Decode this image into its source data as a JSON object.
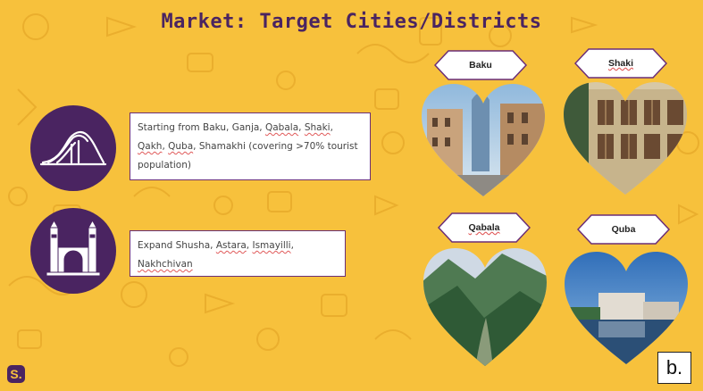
{
  "slide": {
    "title": "Market: Target Cities/Districts",
    "colors": {
      "background": "#f7c13c",
      "accent": "#4a2461",
      "border": "#6a2e78"
    }
  },
  "left": {
    "items": [
      {
        "icon": "heydar-aliyev-center-icon",
        "segments": [
          {
            "text": "Starting from Baku, Ganja, ",
            "u": false
          },
          {
            "text": "Qabala",
            "u": true
          },
          {
            "text": ", ",
            "u": false
          },
          {
            "text": "Shaki",
            "u": true
          },
          {
            "text": ", ",
            "u": false
          },
          {
            "text": "Qakh",
            "u": true
          },
          {
            "text": ", ",
            "u": false
          },
          {
            "text": "Quba",
            "u": true
          },
          {
            "text": ", Shamakhi (covering >70% tourist population)",
            "u": false
          }
        ]
      },
      {
        "icon": "mosque-icon",
        "segments": [
          {
            "text": "Expand Shusha, ",
            "u": false
          },
          {
            "text": "Astara",
            "u": true
          },
          {
            "text": ", ",
            "u": false
          },
          {
            "text": "Ismayilli",
            "u": true
          },
          {
            "text": ", ",
            "u": false
          },
          {
            "text": "Nakhchivan",
            "u": true
          }
        ]
      }
    ]
  },
  "cities": [
    {
      "label": "Baku",
      "photo": "baku-photo"
    },
    {
      "label": "Shaki",
      "photo": "shaki-photo"
    },
    {
      "label": "Qabala",
      "photo": "qabala-photo"
    },
    {
      "label": "Quba",
      "photo": "quba-photo"
    }
  ],
  "logos": {
    "left": "S.",
    "right": "b."
  }
}
